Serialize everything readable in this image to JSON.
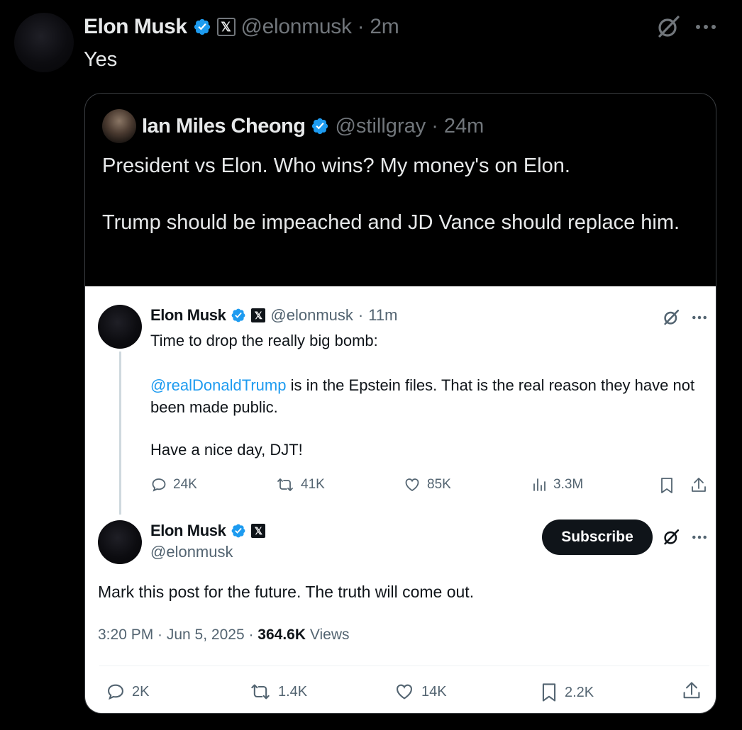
{
  "outer": {
    "author": "Elon Musk",
    "handle": "@elonmusk",
    "sep": "·",
    "time": "2m",
    "text": "Yes",
    "x_badge": "𝕏",
    "more": "···"
  },
  "quote": {
    "author": "Ian Miles Cheong",
    "handle": "@stillgray",
    "sep": "·",
    "time": "24m",
    "text_line1": "President vs Elon. Who wins? My money's on Elon.",
    "text_line2": "Trump should be impeached and JD Vance should replace him."
  },
  "screenshot": {
    "first_post": {
      "author": "Elon Musk",
      "handle": "@elonmusk",
      "sep": "·",
      "time": "11m",
      "x_badge": "𝕏",
      "more": "···",
      "text_line1": "Time to drop the really big bomb:",
      "mention": "@realDonaldTrump",
      "text_line2_rest": " is in the Epstein files. That is the real reason they have not been made public.",
      "text_line3": "Have a nice day, DJT!",
      "replies": "24K",
      "reposts": "41K",
      "likes": "85K",
      "views": "3.3M"
    },
    "second_post": {
      "author": "Elon Musk",
      "handle": "@elonmusk",
      "x_badge": "𝕏",
      "subscribe_label": "Subscribe",
      "more": "···",
      "text": "Mark this post for the future. The truth will come out.",
      "timestamp": "3:20 PM · Jun 5, 2025 · ",
      "views_count": "364.6K",
      "views_label": " Views",
      "replies": "2K",
      "reposts": "1.4K",
      "likes": "14K",
      "bookmarks": "2.2K"
    }
  },
  "colors": {
    "verified_blue": "#1d9bf0",
    "link_blue": "#1d9bf0",
    "dark_text": "#0f1419",
    "muted_gray": "#536471"
  }
}
